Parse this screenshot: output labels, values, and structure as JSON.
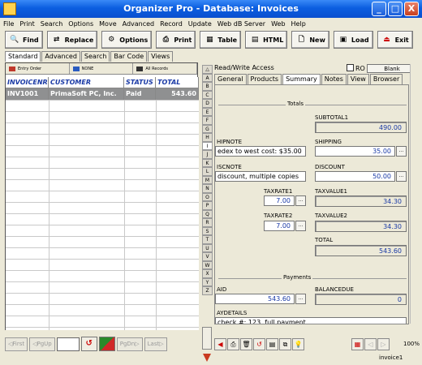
{
  "window": {
    "title": "Organizer Pro - Database: Invoices",
    "min": "_",
    "max": "□",
    "close": "X"
  },
  "menu": [
    "File",
    "Print",
    "Search",
    "Options",
    "Move",
    "Advanced",
    "Record",
    "Update",
    "Web dB Server",
    "Web",
    "Help"
  ],
  "toolbar": [
    {
      "label": "Find",
      "icon": "find-icon",
      "glyph": "🔍"
    },
    {
      "label": "Replace",
      "icon": "replace-icon",
      "glyph": "⇄"
    },
    {
      "label": "Options",
      "icon": "options-icon",
      "glyph": "⚙"
    },
    {
      "label": "Print",
      "icon": "print-icon",
      "glyph": "⎙"
    },
    {
      "label": "Table",
      "icon": "table-icon",
      "glyph": "▦"
    },
    {
      "label": "HTML",
      "icon": "html-icon",
      "glyph": "▤"
    },
    {
      "label": "New",
      "icon": "new-icon",
      "glyph": "🗋"
    },
    {
      "label": "Load",
      "icon": "load-icon",
      "glyph": "▣"
    },
    {
      "label": "Exit",
      "icon": "exit-icon",
      "glyph": "⏏"
    }
  ],
  "left_tabs": [
    "Standard",
    "Advanced",
    "Search",
    "Bar Code",
    "Views"
  ],
  "sortbar": [
    "Entry Order",
    "NONE",
    "All Records"
  ],
  "grid": {
    "columns": [
      "INVOICENR",
      "CUSTOMER",
      "STATUS",
      "TOTAL"
    ],
    "rows": [
      [
        "INV1001",
        "PrimaSoft PC, Inc.",
        "Paid",
        "543.60"
      ]
    ]
  },
  "left_nav": {
    "first": "First",
    "pgup": "PgUp",
    "pgdn": "PgDn",
    "last": "Last"
  },
  "letters": [
    "A",
    "B",
    "C",
    "D",
    "E",
    "F",
    "G",
    "H",
    "I",
    "J",
    "K",
    "L",
    "M",
    "N",
    "O",
    "P",
    "Q",
    "R",
    "S",
    "T",
    "U",
    "V",
    "W",
    "X",
    "Y",
    "Z"
  ],
  "access": "Read/Write Access",
  "ro_label": "RO",
  "blank_label": "Blank",
  "right_tabs": [
    "General",
    "Products",
    "Summary",
    "Notes",
    "View",
    "Browser"
  ],
  "summary": {
    "totals_label": "Totals",
    "subtotal1_label": "SUBTOTAL1",
    "subtotal1": "490.00",
    "shipnote_label": "HIPNOTE",
    "shipnote": "edex to west cost: $35.00",
    "shipping_label": "SHIPPING",
    "shipping": "35.00",
    "discnote_label": "ISCNOTE",
    "discnote": "discount, multiple copies",
    "discount_label": "DISCOUNT",
    "discount": "50.00",
    "taxrate1_label": "TAXRATE1",
    "taxrate1": "7.00",
    "taxvalue1_label": "TAXVALUE1",
    "taxvalue1": "34.30",
    "taxrate2_label": "TAXRATE2",
    "taxrate2": "7.00",
    "taxvalue2_label": "TAXVALUE2",
    "taxvalue2": "34.30",
    "total_label": "TOTAL",
    "total": "543.60",
    "payments_label": "Payments",
    "paid_label": "AID",
    "paid": "543.60",
    "balancedue_label": "BALANCEDUE",
    "balancedue": "0",
    "paydetails_label": "AYDETAILS",
    "paydetails": "check #: 123. full payment",
    "ellipsis": "..."
  },
  "zoom": "100%",
  "record_name": "invoice1",
  "colors": {
    "titlebar": "#0b5ee0",
    "grid_header": "#1a3aa6",
    "selected_row": "#8f9091",
    "value_text": "#1a3aa6"
  }
}
